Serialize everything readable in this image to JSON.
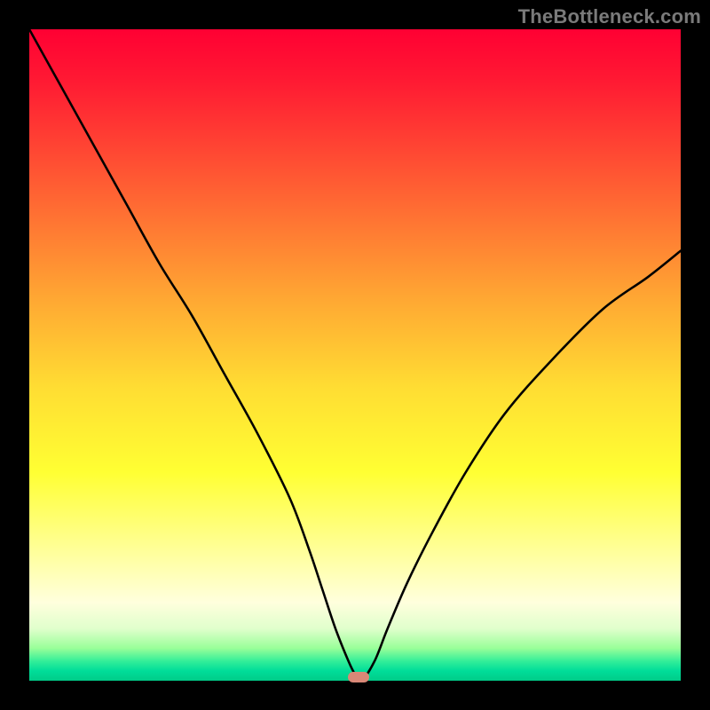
{
  "watermark": "TheBottleneck.com",
  "chart_data": {
    "type": "line",
    "title": "",
    "xlabel": "",
    "ylabel": "",
    "xlim": [
      0,
      100
    ],
    "ylim": [
      0,
      100
    ],
    "grid": false,
    "legend": false,
    "background_gradient": {
      "top": "#ff0033",
      "mid": "#ffff33",
      "bottom": "#00dd99"
    },
    "series": [
      {
        "name": "bottleneck-curve",
        "color": "#000000",
        "x": [
          0,
          5,
          10,
          15,
          20,
          25,
          30,
          35,
          40,
          43,
          45,
          47,
          49,
          50,
          51,
          53,
          55,
          58,
          62,
          67,
          73,
          80,
          88,
          95,
          100
        ],
        "y": [
          100,
          91,
          82,
          73,
          64,
          56,
          47,
          38,
          28,
          20,
          14,
          8,
          3,
          1,
          0,
          3,
          8,
          15,
          23,
          32,
          41,
          49,
          57,
          62,
          66
        ]
      }
    ],
    "marker": {
      "name": "optimal-point",
      "x": 50.5,
      "y": 0.5,
      "color": "#d98877"
    }
  }
}
